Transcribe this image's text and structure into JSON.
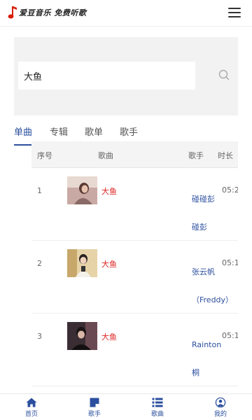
{
  "header": {
    "logo_text": "爱豆音乐 免费听歌",
    "menu_icon": "hamburger-menu-icon"
  },
  "search": {
    "value": "大鱼",
    "placeholder": "",
    "icon": "search-icon"
  },
  "tabs": [
    {
      "label": "单曲",
      "active": true
    },
    {
      "label": "专辑",
      "active": false
    },
    {
      "label": "歌单",
      "active": false
    },
    {
      "label": "歌手",
      "active": false
    }
  ],
  "table": {
    "headers": {
      "no": "序号",
      "song": "歌曲",
      "singer": "歌手",
      "duration": "时长"
    },
    "rows": [
      {
        "no": "1",
        "song": "大鱼",
        "singer_line1": "碰碰彭",
        "singer_line2": "碰彭",
        "duration": "05:2"
      },
      {
        "no": "2",
        "song": "大鱼",
        "singer_line1": "张云帆",
        "singer_line2": "（Freddy）",
        "duration": "05:1"
      },
      {
        "no": "3",
        "song": "大鱼",
        "singer_line1": "Rainton",
        "singer_line2": "桐",
        "duration": "05:1"
      }
    ]
  },
  "bottom_nav": [
    {
      "label": "首页",
      "icon": "home-icon"
    },
    {
      "label": "歌手",
      "icon": "singer-icon"
    },
    {
      "label": "歌曲",
      "icon": "song-list-icon"
    },
    {
      "label": "我的",
      "icon": "user-icon"
    }
  ],
  "colors": {
    "accent": "#2b4f9e",
    "song_title": "#dd2222",
    "logo_red": "#d81e06",
    "panel_bg": "#f2f2f2"
  }
}
